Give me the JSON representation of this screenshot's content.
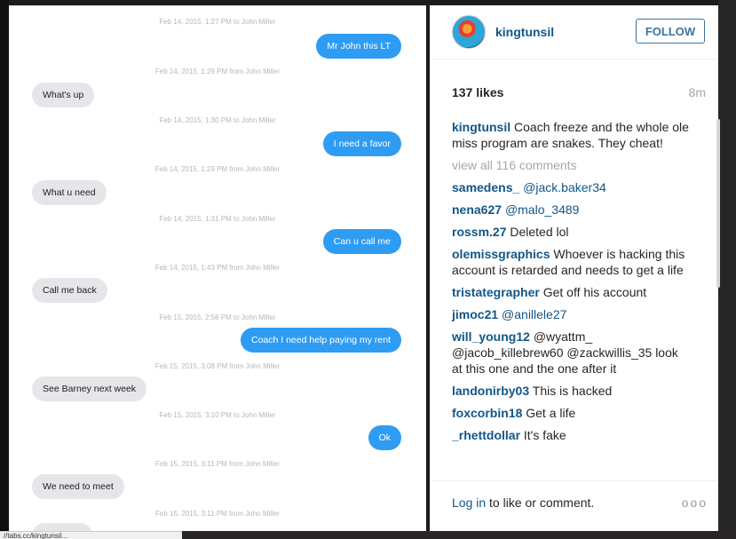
{
  "photo": {
    "messages": [
      {
        "time": "Feb 14, 2015, 1:27 PM to John Miller",
        "text": "Mr John this LT",
        "dir": "out"
      },
      {
        "time": "Feb 14, 2015, 1:29 PM from John Miller",
        "text": "What's up",
        "dir": "in"
      },
      {
        "time": "Feb 14, 2015, 1:30 PM to John Miller",
        "text": "I need a favor",
        "dir": "out"
      },
      {
        "time": "Feb 14, 2015, 1:29 PM from John Miller",
        "text": "What u need",
        "dir": "in"
      },
      {
        "time": "Feb 14, 2015, 1:31 PM to John Miller",
        "text": "Can u call me",
        "dir": "out"
      },
      {
        "time": "Feb 14, 2015, 1:43 PM from John Miller",
        "text": "Call me back",
        "dir": "in"
      },
      {
        "time": "Feb 15, 2015, 2:58 PM to John Miller",
        "text": "Coach I need help paying my rent",
        "dir": "out"
      },
      {
        "time": "Feb 15, 2015, 3:08 PM from John Miller",
        "text": "See Barney next week",
        "dir": "in"
      },
      {
        "time": "Feb 15, 2015, 3:10 PM to John Miller",
        "text": "Ok",
        "dir": "out"
      },
      {
        "time": "Feb 15, 2015, 3:11 PM from John Miller",
        "text": "We need to meet",
        "dir": "in"
      },
      {
        "time": "Feb 15, 2015, 3:11 PM from John Miller",
        "text": "",
        "dir": "in"
      }
    ]
  },
  "post": {
    "username": "kingtunsil",
    "follow_label": "FOLLOW",
    "likes": "137 likes",
    "time_ago": "8m",
    "caption": {
      "user": "kingtunsil",
      "text": "Coach freeze and the whole ole miss program are snakes. They cheat!"
    },
    "view_all": "view all 116 comments",
    "comments": [
      {
        "user": "samedens_",
        "text": "@jack.baker34"
      },
      {
        "user": "nena627",
        "text": "@malo_3489"
      },
      {
        "user": "rossm.27",
        "text": "Deleted lol"
      },
      {
        "user": "olemissgraphics",
        "text": "Whoever is hacking this account is retarded and needs to get a life"
      },
      {
        "user": "tristategrapher",
        "text": "Get off his account"
      },
      {
        "user": "jimoc21",
        "text": "@anillele27"
      },
      {
        "user": "will_young12",
        "text": "@wyattm_ @jacob_killebrew60 @zackwillis_35 look at this one and the one after it"
      },
      {
        "user": "landonirby03",
        "text": "This is hacked"
      },
      {
        "user": "foxcorbin18",
        "text": "Get a life"
      },
      {
        "user": "_rhettdollar",
        "text": "It's fake"
      }
    ],
    "login_label": "Log in",
    "login_suffix": " to like or comment.",
    "more_label": "ooo"
  },
  "status_bar": {
    "url": "//tabs.cc/kingtunsil..."
  },
  "colors": {
    "accent": "#125688",
    "bubble_out": "#2f9cf3",
    "bubble_in": "#e5e5ea"
  }
}
